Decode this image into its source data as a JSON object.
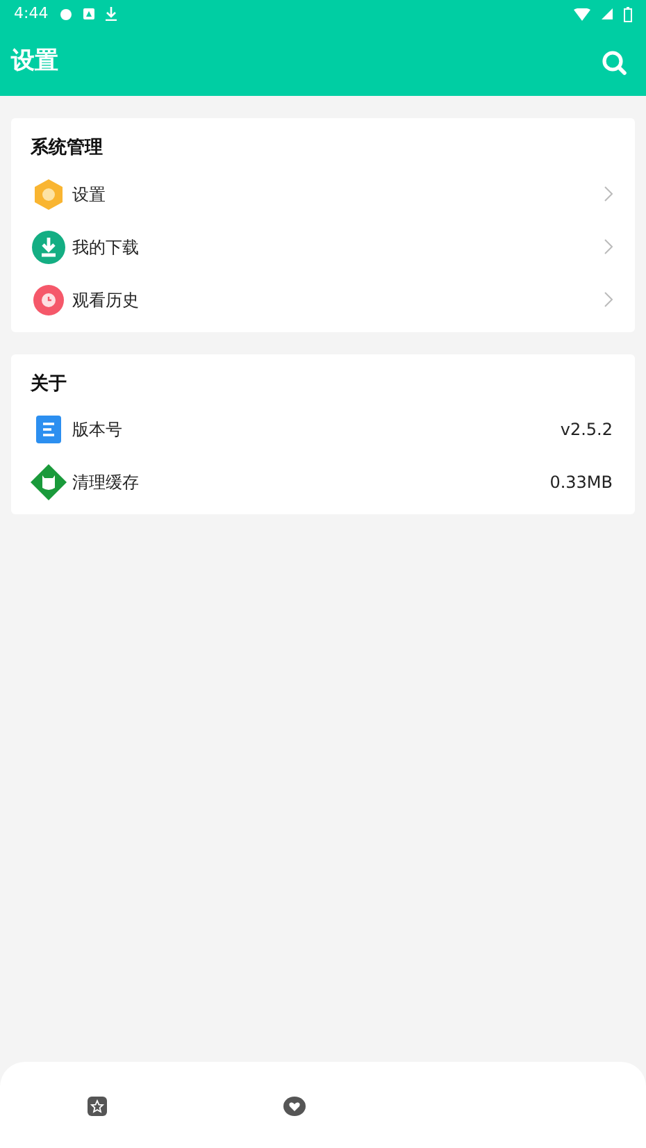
{
  "status_bar": {
    "time": "4:44"
  },
  "app_bar": {
    "title": "设置"
  },
  "sections": [
    {
      "title": "系统管理",
      "items": [
        {
          "kind": "link",
          "label": "设置"
        },
        {
          "kind": "link",
          "label": "我的下载"
        },
        {
          "kind": "link",
          "label": "观看历史"
        }
      ]
    },
    {
      "title": "关于",
      "items": [
        {
          "kind": "value",
          "label": "版本号",
          "value": "v2.5.2"
        },
        {
          "kind": "value",
          "label": "清理缓存",
          "value": "0.33MB"
        }
      ]
    }
  ]
}
